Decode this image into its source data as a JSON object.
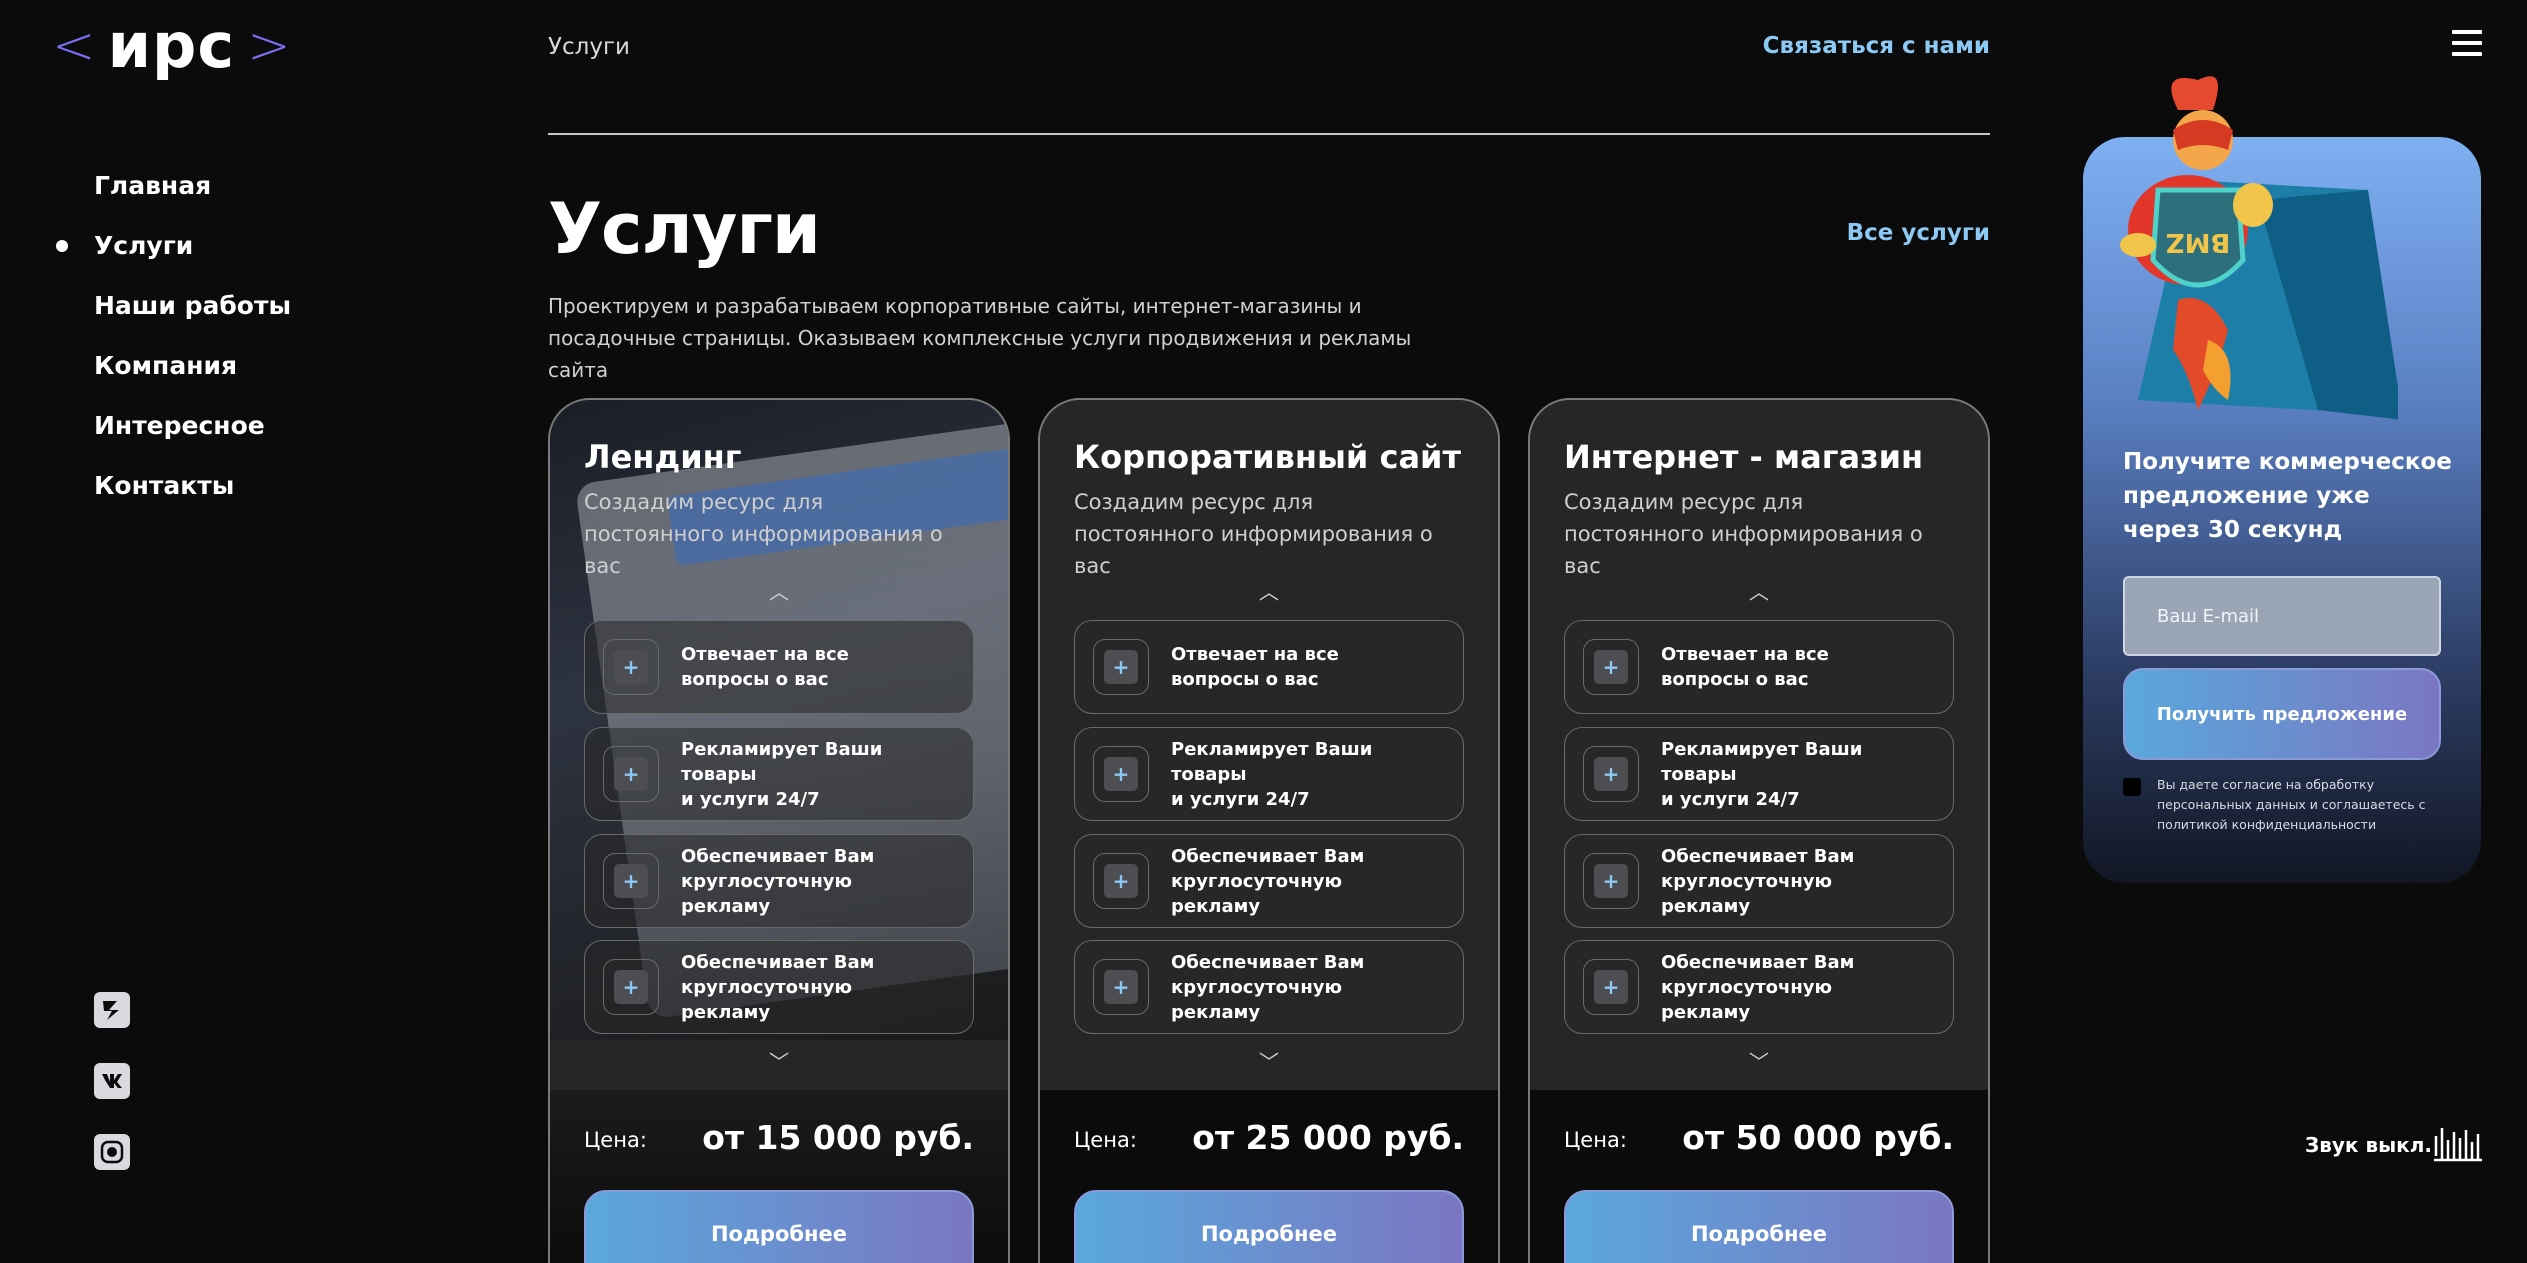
{
  "logo": {
    "left_bracket": "<",
    "text": "ирс",
    "right_bracket": ">"
  },
  "nav": {
    "items": [
      {
        "label": "Главная",
        "active": false
      },
      {
        "label": "Услуги",
        "active": true
      },
      {
        "label": "Наши работы",
        "active": false
      },
      {
        "label": "Компания",
        "active": false
      },
      {
        "label": "Интересное",
        "active": false
      },
      {
        "label": "Контакты",
        "active": false
      }
    ]
  },
  "social": [
    {
      "icon": "yandex-zen-icon"
    },
    {
      "icon": "vk-icon"
    },
    {
      "icon": "instagram-icon"
    }
  ],
  "header": {
    "breadcrumb": "Услуги",
    "contact_link": "Связаться с нами",
    "menu_icon": "hamburger-menu-icon"
  },
  "main": {
    "title": "Услуги",
    "all_services_link": "Все услуги",
    "description": "Проектируем и разрабатываем корпоративные сайты, интернет-магазины и посадочные страницы. Оказываем комплексные услуги продвижения и рекламы сайта"
  },
  "cards": [
    {
      "title": "Лендинг",
      "subtitle": "Создадим ресурс для постоянного информирования о вас",
      "features": [
        {
          "line1": "Отвечает на все",
          "line2": "вопросы о вас"
        },
        {
          "line1": "Рекламирует Ваши товары",
          "line2": "и услуги 24/7"
        },
        {
          "line1": "Обеспечивает Вам",
          "line2": "круглосуточную рекламу"
        },
        {
          "line1": "Обеспечивает Вам",
          "line2": "круглосуточную рекламу"
        }
      ],
      "price_label": "Цена:",
      "price": "от 15 000 руб.",
      "button": "Подробнее"
    },
    {
      "title": "Корпоративный сайт",
      "subtitle": "Создадим ресурс для постоянного информирования о вас",
      "features": [
        {
          "line1": "Отвечает на все",
          "line2": "вопросы о вас"
        },
        {
          "line1": "Рекламирует Ваши товары",
          "line2": "и услуги 24/7"
        },
        {
          "line1": "Обеспечивает Вам",
          "line2": "круглосуточную рекламу"
        },
        {
          "line1": "Обеспечивает Вам",
          "line2": "круглосуточную рекламу"
        }
      ],
      "price_label": "Цена:",
      "price": "от 25 000 руб.",
      "button": "Подробнее"
    },
    {
      "title": "Интернет - магазин",
      "subtitle": "Создадим ресурс для постоянного информирования о вас",
      "features": [
        {
          "line1": "Отвечает на все",
          "line2": "вопросы о вас"
        },
        {
          "line1": "Рекламирует Ваши товары",
          "line2": "и услуги 24/7"
        },
        {
          "line1": "Обеспечивает Вам",
          "line2": "круглосуточную рекламу"
        },
        {
          "line1": "Обеспечивает Вам",
          "line2": "круглосуточную рекламу"
        }
      ],
      "price_label": "Цена:",
      "price": "от 50 000 руб.",
      "button": "Подробнее"
    }
  ],
  "form": {
    "heading": "Получите коммерческое предложение уже через 30 секунд",
    "email_placeholder": "Ваш E-mail",
    "email_value": "",
    "submit": "Получить предложение",
    "consent": "Вы даете согласие на обработку персональных данных и соглашаетесь с политикой конфиденциальности",
    "consent_checked": false
  },
  "mascot": {
    "shield_text": "BMZ"
  },
  "sound": {
    "label": "Звук выкл.",
    "icon": "sound-wave-icon"
  },
  "colors": {
    "accent": "#8cc9f4",
    "logo_bracket": "#7a6ff0",
    "button_from": "#5aa8dc",
    "button_to": "#7a76c2"
  }
}
